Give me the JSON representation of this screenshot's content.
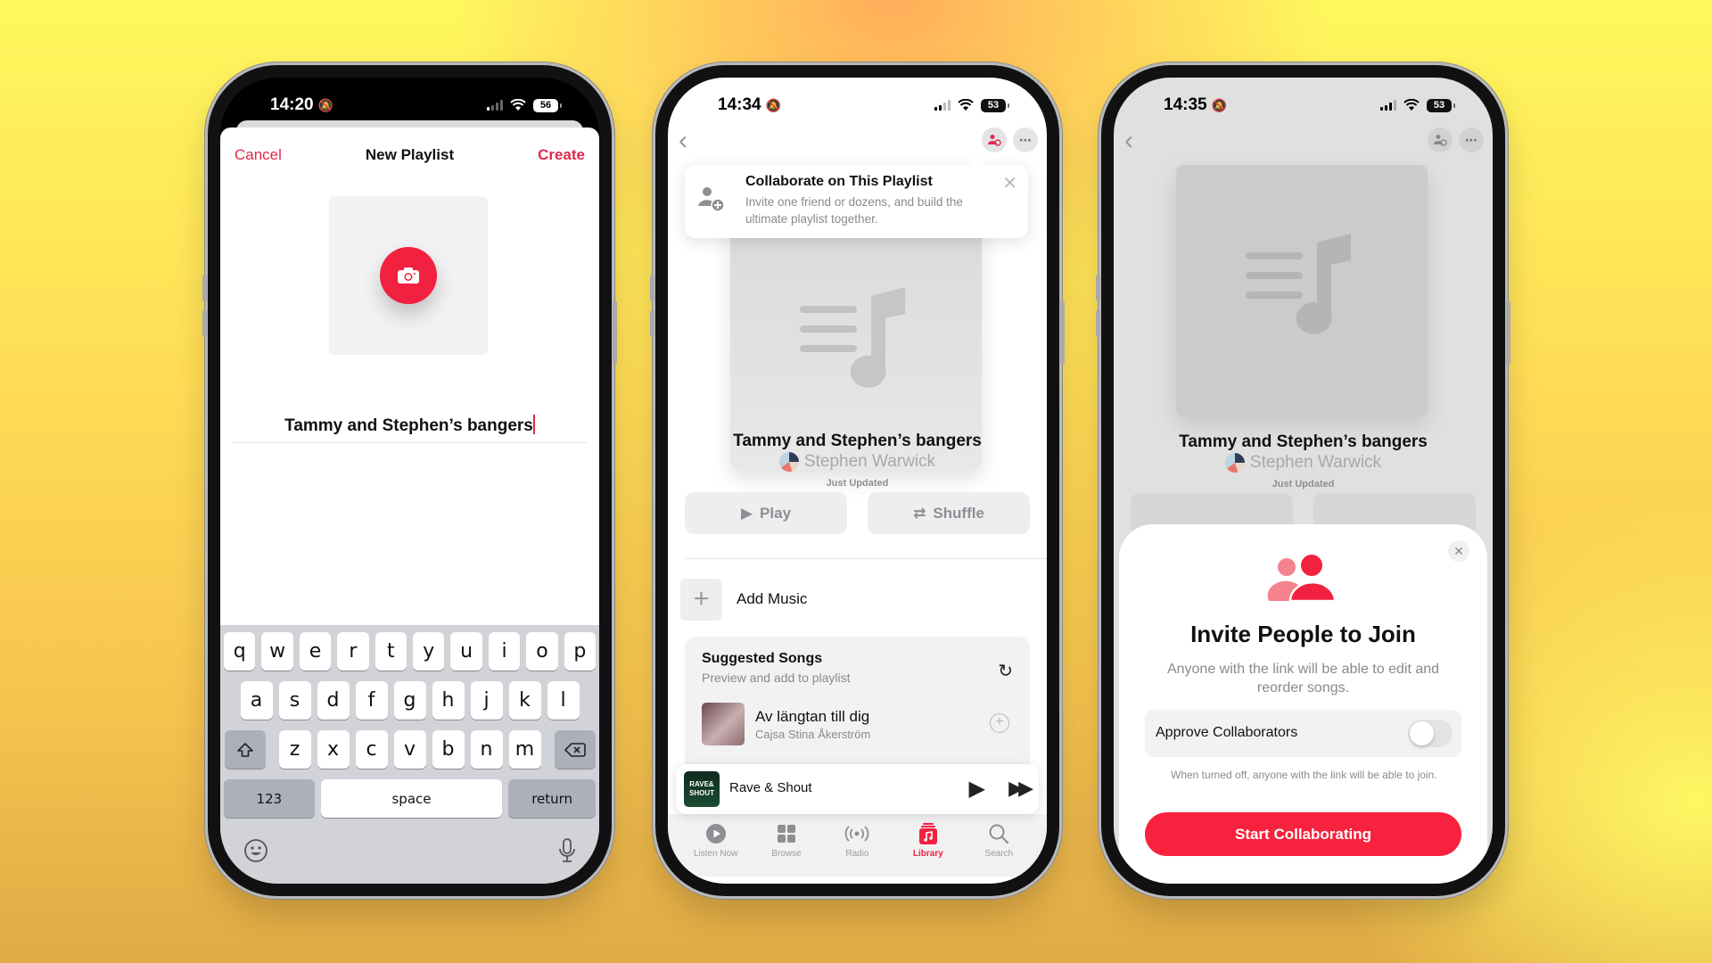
{
  "colors": {
    "accent": "#f2213f",
    "accent_text": "#e0284a"
  },
  "phone1": {
    "status": {
      "time": "14:20",
      "battery": "56"
    },
    "nav": {
      "cancel": "Cancel",
      "title": "New Playlist",
      "create": "Create"
    },
    "name_field": {
      "value": "Tammy and Stephen’s bangers"
    },
    "keyboard": {
      "row1": [
        "q",
        "w",
        "e",
        "r",
        "t",
        "y",
        "u",
        "i",
        "o",
        "p"
      ],
      "row2": [
        "a",
        "s",
        "d",
        "f",
        "g",
        "h",
        "j",
        "k",
        "l"
      ],
      "row3": [
        "z",
        "x",
        "c",
        "v",
        "b",
        "n",
        "m"
      ],
      "numbers": "123",
      "space": "space",
      "return": "return"
    }
  },
  "phone2": {
    "status": {
      "time": "14:34",
      "battery": "53"
    },
    "tooltip": {
      "title": "Collaborate on This Playlist",
      "description": "Invite one friend or dozens, and build the ultimate playlist together."
    },
    "playlist": {
      "title": "Tammy and Stephen’s bangers",
      "author": "Stephen Warwick",
      "updated": "Just Updated"
    },
    "buttons": {
      "play": "Play",
      "shuffle": "Shuffle",
      "add_music": "Add Music"
    },
    "suggested": {
      "title": "Suggested Songs",
      "subtitle": "Preview and add to playlist",
      "songs": [
        {
          "title": "Av längtan till dig",
          "artist": "Cajsa Stina Åkerström"
        }
      ]
    },
    "mini_player": {
      "title": "Rave & Shout",
      "art_text": "RAVE& SHOUT"
    },
    "tabs": [
      {
        "label": "Listen Now",
        "active": false
      },
      {
        "label": "Browse",
        "active": false
      },
      {
        "label": "Radio",
        "active": false
      },
      {
        "label": "Library",
        "active": true
      },
      {
        "label": "Search",
        "active": false
      }
    ]
  },
  "phone3": {
    "status": {
      "time": "14:35",
      "battery": "53"
    },
    "playlist": {
      "title": "Tammy and Stephen’s bangers",
      "author": "Stephen Warwick",
      "updated": "Just Updated"
    },
    "sheet": {
      "title": "Invite People to Join",
      "description": "Anyone with the link will be able to edit and reorder songs.",
      "toggle_label": "Approve Collaborators",
      "toggle_on": false,
      "toggle_caption": "When turned off, anyone with the link will be able to join.",
      "cta": "Start Collaborating"
    }
  }
}
